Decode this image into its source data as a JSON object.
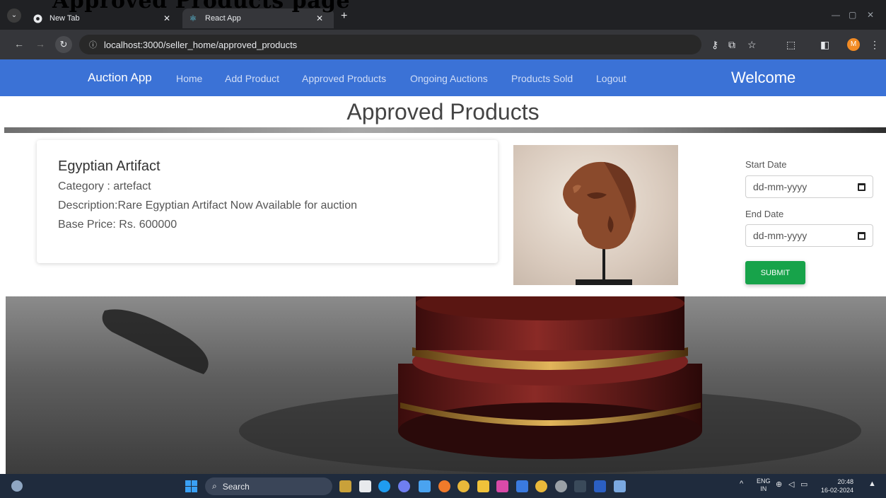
{
  "document": {
    "heading_fragment": "Approved Products page"
  },
  "browser": {
    "tabs": [
      {
        "label": "New Tab"
      },
      {
        "label": "React App"
      }
    ],
    "url": "localhost:3000/seller_home/approved_products",
    "profile_initial": "M"
  },
  "navbar": {
    "brand": "Auction App",
    "links": [
      "Home",
      "Add Product",
      "Approved Products",
      "Ongoing Auctions",
      "Products Sold",
      "Logout"
    ],
    "welcome": "Welcome"
  },
  "page": {
    "title": "Approved Products"
  },
  "product": {
    "name": "Egyptian Artifact",
    "category": "Category : artefact",
    "description": "Description:Rare Egyptian Artifact Now Available for auction",
    "base_price": "Base Price: Rs. 600000"
  },
  "form": {
    "start_label": "Start Date",
    "start_placeholder": "dd-mm-yyyy",
    "end_label": "End Date",
    "end_placeholder": "dd-mm-yyyy",
    "submit_label": "SUBMIT"
  },
  "taskbar": {
    "search_label": "Search",
    "lang_top": "ENG",
    "lang_bottom": "IN",
    "time": "20:48",
    "date": "16-02-2024"
  },
  "colors": {
    "navbar": "#3b72d6",
    "submit": "#17a34a",
    "browser_frame": "#202124"
  }
}
